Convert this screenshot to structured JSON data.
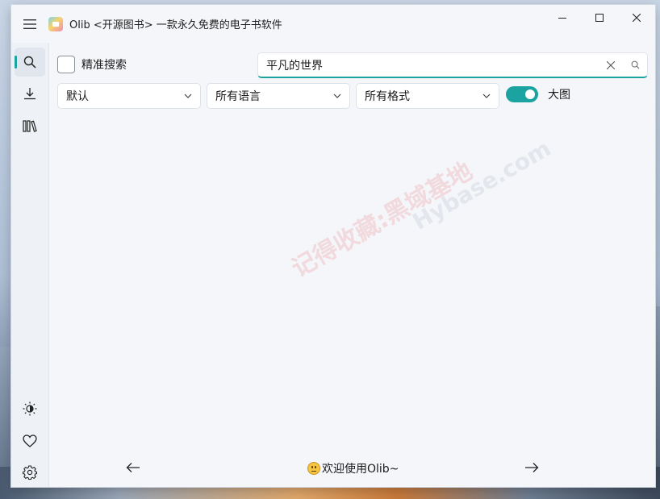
{
  "window": {
    "title": "Olib <开源图书> 一款永久免费的电子书软件"
  },
  "rail": {
    "items": [
      {
        "name": "search",
        "icon": "search-icon",
        "active": true
      },
      {
        "name": "download",
        "icon": "download-icon",
        "active": false
      },
      {
        "name": "library",
        "icon": "library-icon",
        "active": false
      }
    ],
    "bottom_items": [
      {
        "name": "theme",
        "icon": "brightness-icon"
      },
      {
        "name": "favorite",
        "icon": "heart-icon"
      },
      {
        "name": "settings",
        "icon": "gear-icon"
      }
    ]
  },
  "search": {
    "exact_label": "精准搜索",
    "exact_checked": false,
    "query": "平凡的世界"
  },
  "filters": {
    "sort": "默认",
    "language": "所有语言",
    "format": "所有格式",
    "big_image_label": "大图",
    "big_image_on": true
  },
  "footer": {
    "welcome": "欢迎使用Olib~"
  },
  "watermark": {
    "text1": "记得收藏:黑域基地",
    "text2": "Hybase.com"
  },
  "colors": {
    "accent": "#1aa3a0",
    "window_bg": "#f4f6fa"
  }
}
